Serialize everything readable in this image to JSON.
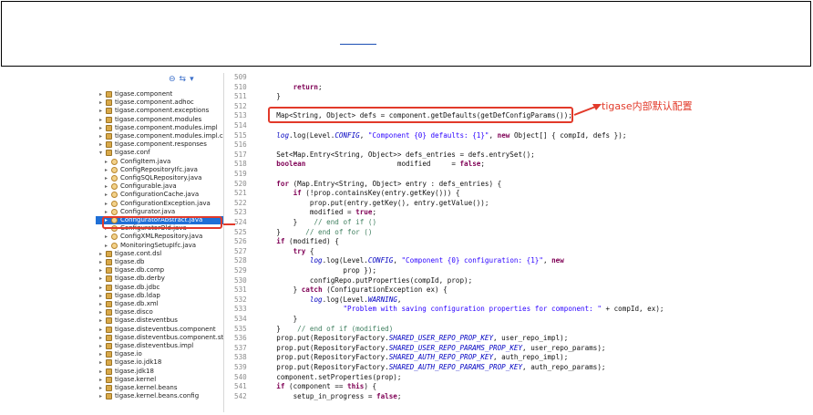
{
  "annotation": "tigase内部默认配置",
  "tree_toolbar": [
    "⊖",
    "⇆",
    "▾"
  ],
  "tree": [
    {
      "label": "tigase.component",
      "type": "pkg",
      "indent": 0,
      "tw": "▸"
    },
    {
      "label": "tigase.component.adhoc",
      "type": "pkg",
      "indent": 0,
      "tw": "▸"
    },
    {
      "label": "tigase.component.exceptions",
      "type": "pkg",
      "indent": 0,
      "tw": "▸"
    },
    {
      "label": "tigase.component.modules",
      "type": "pkg",
      "indent": 0,
      "tw": "▸"
    },
    {
      "label": "tigase.component.modules.impl",
      "type": "pkg",
      "indent": 0,
      "tw": "▸"
    },
    {
      "label": "tigase.component.modules.impl.config",
      "type": "pkg",
      "indent": 0,
      "tw": "▸"
    },
    {
      "label": "tigase.component.responses",
      "type": "pkg",
      "indent": 0,
      "tw": "▸"
    },
    {
      "label": "tigase.conf",
      "type": "pkg",
      "indent": 0,
      "tw": "▾"
    },
    {
      "label": "ConfigItem.java",
      "type": "java",
      "indent": 1,
      "tw": "▸"
    },
    {
      "label": "ConfigRepositoryIfc.java",
      "type": "java",
      "indent": 1,
      "tw": "▸"
    },
    {
      "label": "ConfigSQLRepository.java",
      "type": "java",
      "indent": 1,
      "tw": "▸"
    },
    {
      "label": "Configurable.java",
      "type": "java",
      "indent": 1,
      "tw": "▸"
    },
    {
      "label": "ConfigurationCache.java",
      "type": "java",
      "indent": 1,
      "tw": "▸"
    },
    {
      "label": "ConfigurationException.java",
      "type": "java",
      "indent": 1,
      "tw": "▸"
    },
    {
      "label": "Configurator.java",
      "type": "java",
      "indent": 1,
      "tw": "▸"
    },
    {
      "label": "ConfiguratorAbstract.java",
      "type": "java",
      "indent": 1,
      "tw": "▸",
      "selected": true
    },
    {
      "label": "ConfiguratorOld.java",
      "type": "java",
      "indent": 1,
      "tw": "▸"
    },
    {
      "label": "ConfigXMLRepository.java",
      "type": "java",
      "indent": 1,
      "tw": "▸"
    },
    {
      "label": "MonitoringSetupIfc.java",
      "type": "java",
      "indent": 1,
      "tw": "▸"
    },
    {
      "label": "tigase.cont.dsl",
      "type": "pkg",
      "indent": 0,
      "tw": "▸"
    },
    {
      "label": "tigase.db",
      "type": "pkg",
      "indent": 0,
      "tw": "▸"
    },
    {
      "label": "tigase.db.comp",
      "type": "pkg",
      "indent": 0,
      "tw": "▸"
    },
    {
      "label": "tigase.db.derby",
      "type": "pkg",
      "indent": 0,
      "tw": "▸"
    },
    {
      "label": "tigase.db.jdbc",
      "type": "pkg",
      "indent": 0,
      "tw": "▸"
    },
    {
      "label": "tigase.db.ldap",
      "type": "pkg",
      "indent": 0,
      "tw": "▸"
    },
    {
      "label": "tigase.db.xml",
      "type": "pkg",
      "indent": 0,
      "tw": "▸"
    },
    {
      "label": "tigase.disco",
      "type": "pkg",
      "indent": 0,
      "tw": "▸"
    },
    {
      "label": "tigase.disteventbus",
      "type": "pkg",
      "indent": 0,
      "tw": "▸"
    },
    {
      "label": "tigase.disteventbus.component",
      "type": "pkg",
      "indent": 0,
      "tw": "▸"
    },
    {
      "label": "tigase.disteventbus.component.stores",
      "type": "pkg",
      "indent": 0,
      "tw": "▸"
    },
    {
      "label": "tigase.disteventbus.impl",
      "type": "pkg",
      "indent": 0,
      "tw": "▸"
    },
    {
      "label": "tigase.io",
      "type": "pkg",
      "indent": 0,
      "tw": "▸"
    },
    {
      "label": "tigase.io.jdk18",
      "type": "pkg",
      "indent": 0,
      "tw": "▸"
    },
    {
      "label": "tigase.jdk18",
      "type": "pkg",
      "indent": 0,
      "tw": "▸"
    },
    {
      "label": "tigase.kernel",
      "type": "pkg",
      "indent": 0,
      "tw": "▸"
    },
    {
      "label": "tigase.kernel.beans",
      "type": "pkg",
      "indent": 0,
      "tw": "▸"
    },
    {
      "label": "tigase.kernel.beans.config",
      "type": "pkg",
      "indent": 0,
      "tw": "▸"
    }
  ],
  "line_numbers": [
    509,
    510,
    511,
    512,
    513,
    514,
    515,
    516,
    517,
    518,
    519,
    520,
    521,
    522,
    523,
    524,
    525,
    526,
    527,
    528,
    529,
    530,
    531,
    532,
    533,
    534,
    535,
    536,
    537,
    538,
    539,
    540,
    541,
    542
  ],
  "code_lines": [
    [],
    [
      [
        "",
        "        "
      ],
      [
        "kw",
        "return"
      ],
      [
        "",
        ";"
      ]
    ],
    [
      [
        "",
        "    }"
      ]
    ],
    [],
    [
      [
        "",
        "    Map<String, Object> defs = component.getDefaults(getDefConfigParams());"
      ]
    ],
    [],
    [
      [
        "",
        "    "
      ],
      [
        "fld",
        "log"
      ],
      [
        "",
        ".log(Level."
      ],
      [
        "fld",
        "CONFIG"
      ],
      [
        "",
        ", "
      ],
      [
        "str",
        "\"Component {0} defaults: {1}\""
      ],
      [
        "",
        ", "
      ],
      [
        "kw",
        "new"
      ],
      [
        "",
        " Object[] { compId, defs });"
      ]
    ],
    [],
    [
      [
        "",
        "    Set<Map.Entry<String, Object>> defs_entries = defs.entrySet();"
      ]
    ],
    [
      [
        "",
        "    "
      ],
      [
        "kw",
        "boolean"
      ],
      [
        "",
        "                      modified     = "
      ],
      [
        "kw",
        "false"
      ],
      [
        "",
        ";"
      ]
    ],
    [],
    [
      [
        "",
        "    "
      ],
      [
        "kw",
        "for"
      ],
      [
        "",
        " (Map.Entry<String, Object> entry : defs_entries) {"
      ]
    ],
    [
      [
        "",
        "        "
      ],
      [
        "kw",
        "if"
      ],
      [
        "",
        " (!prop.containsKey(entry.getKey())) {"
      ]
    ],
    [
      [
        "",
        "            prop.put(entry.getKey(), entry.getValue());"
      ]
    ],
    [
      [
        "",
        "            modified = "
      ],
      [
        "kw",
        "true"
      ],
      [
        "",
        ";"
      ]
    ],
    [
      [
        "",
        "        }    "
      ],
      [
        "cm",
        "// end of if ()"
      ]
    ],
    [
      [
        "",
        "    }      "
      ],
      [
        "cm",
        "// end of for ()"
      ]
    ],
    [
      [
        "",
        "    "
      ],
      [
        "kw",
        "if"
      ],
      [
        "",
        " (modified) {"
      ]
    ],
    [
      [
        "",
        "        "
      ],
      [
        "kw",
        "try"
      ],
      [
        "",
        " {"
      ]
    ],
    [
      [
        "",
        "            "
      ],
      [
        "fld",
        "log"
      ],
      [
        "",
        ".log(Level."
      ],
      [
        "fld",
        "CONFIG"
      ],
      [
        "",
        ", "
      ],
      [
        "str",
        "\"Component {0} configuration: {1}\""
      ],
      [
        "",
        ", "
      ],
      [
        "kw",
        "new"
      ],
      [
        "",
        "",
        " Object[] { compId,"
      ]
    ],
    [
      [
        "",
        "                    prop });"
      ]
    ],
    [
      [
        "",
        "            configRepo.putProperties(compId, prop);"
      ]
    ],
    [
      [
        "",
        "        } "
      ],
      [
        "kw",
        "catch"
      ],
      [
        "",
        " (ConfigurationException ex) {"
      ]
    ],
    [
      [
        "",
        "            "
      ],
      [
        "fld",
        "log"
      ],
      [
        "",
        ".log(Level."
      ],
      [
        "fld",
        "WARNING"
      ],
      [
        "",
        ","
      ]
    ],
    [
      [
        "",
        "                    "
      ],
      [
        "str",
        "\"Problem with saving configuration properties for component: \""
      ],
      [
        "",
        " + compId, ex);"
      ]
    ],
    [
      [
        "",
        "        }"
      ]
    ],
    [
      [
        "",
        "    }    "
      ],
      [
        "cm",
        "// end of if (modified)"
      ]
    ],
    [
      [
        "",
        "    prop.put(RepositoryFactory."
      ],
      [
        "fld",
        "SHARED_USER_REPO_PROP_KEY"
      ],
      [
        "",
        ", user_repo_impl);"
      ]
    ],
    [
      [
        "",
        "    prop.put(RepositoryFactory."
      ],
      [
        "fld",
        "SHARED_USER_REPO_PARAMS_PROP_KEY"
      ],
      [
        "",
        ", user_repo_params);"
      ]
    ],
    [
      [
        "",
        "    prop.put(RepositoryFactory."
      ],
      [
        "fld",
        "SHARED_AUTH_REPO_PROP_KEY"
      ],
      [
        "",
        ", auth_repo_impl);"
      ]
    ],
    [
      [
        "",
        "    prop.put(RepositoryFactory."
      ],
      [
        "fld",
        "SHARED_AUTH_REPO_PARAMS_PROP_KEY"
      ],
      [
        "",
        ", auth_repo_params);"
      ]
    ],
    [
      [
        "",
        "    component.setProperties(prop);"
      ]
    ],
    [
      [
        "",
        "    "
      ],
      [
        "kw",
        "if"
      ],
      [
        "",
        " (component == "
      ],
      [
        "kw",
        "this"
      ],
      [
        "",
        ") {"
      ]
    ],
    [
      [
        "",
        "        setup_in_progress = "
      ],
      [
        "kw",
        "false"
      ],
      [
        "",
        ";"
      ]
    ]
  ],
  "colors": {
    "highlight": "#e23a2a",
    "selection": "#1f6fd6",
    "keyword": "#7f0055",
    "field": "#0000c0",
    "string": "#2a00ff",
    "comment": "#3f7f5f"
  }
}
